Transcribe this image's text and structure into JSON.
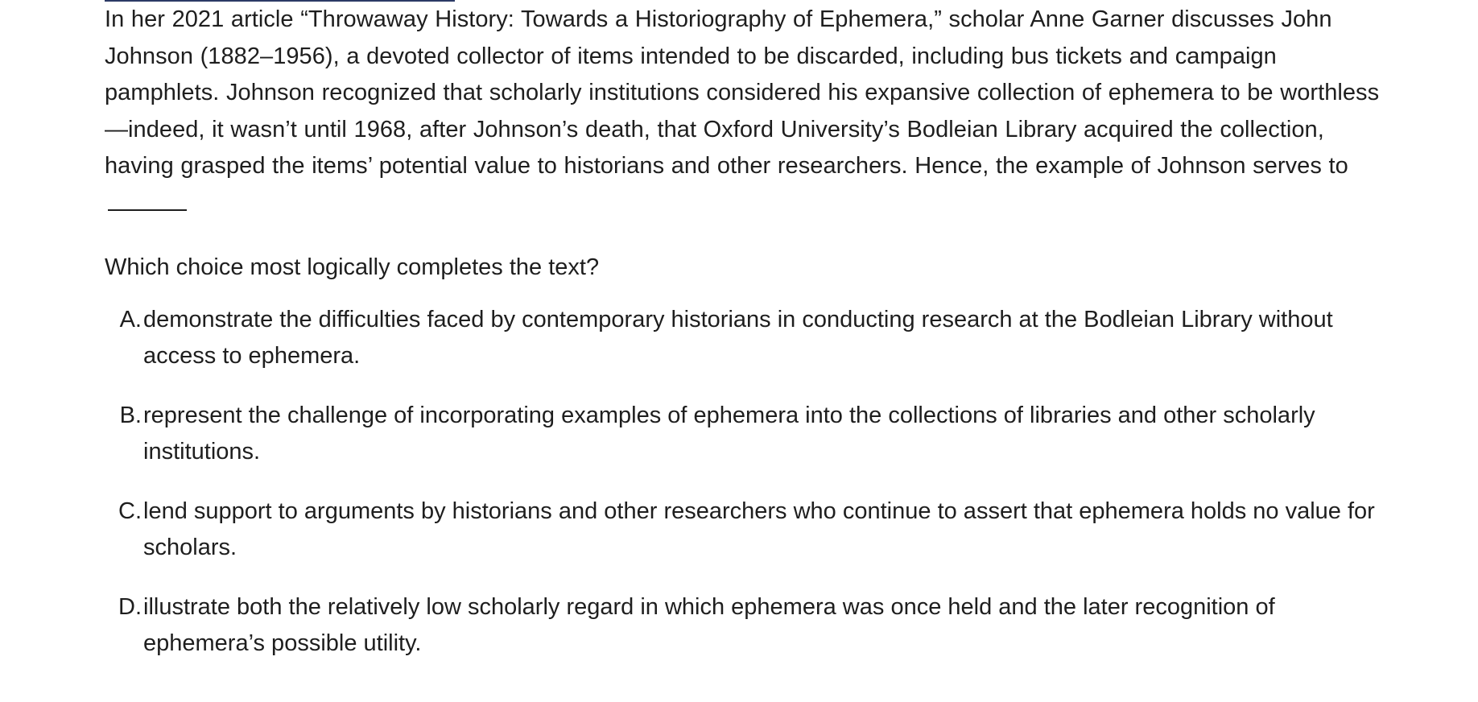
{
  "passage": {
    "text": "In her 2021 article “Throwaway History: Towards a Historiography of Ephemera,” scholar Anne Garner discusses John Johnson (1882–1956), a devoted collector of items intended to be discarded, including bus tickets and campaign pamphlets. Johnson recognized that scholarly institutions considered his expansive collection of ephemera to be worthless—indeed, it wasn’t until 1968, after Johnson’s death, that Oxford University’s Bodleian Library acquired the collection, having grasped the items’ potential value to historians and other researchers. Hence, the example of Johnson serves to"
  },
  "question": {
    "prompt": "Which choice most logically completes the text?"
  },
  "choices": [
    {
      "letter": "A.",
      "text": "demonstrate the difficulties faced by contemporary historians in conducting research at the Bodleian Library without access to ephemera."
    },
    {
      "letter": "B.",
      "text": "represent the challenge of incorporating examples of ephemera into the collections of libraries and other scholarly institutions."
    },
    {
      "letter": "C.",
      "text": "lend support to arguments by historians and other researchers who continue to assert that ephemera holds no value for scholars."
    },
    {
      "letter": "D.",
      "text": "illustrate both the relatively low scholarly regard in which ephemera was once held and the later recognition of ephemera’s possible utility."
    }
  ],
  "colors": {
    "text": "#1e1e1e",
    "top_rule": "#2c3a66",
    "background": "#ffffff"
  }
}
